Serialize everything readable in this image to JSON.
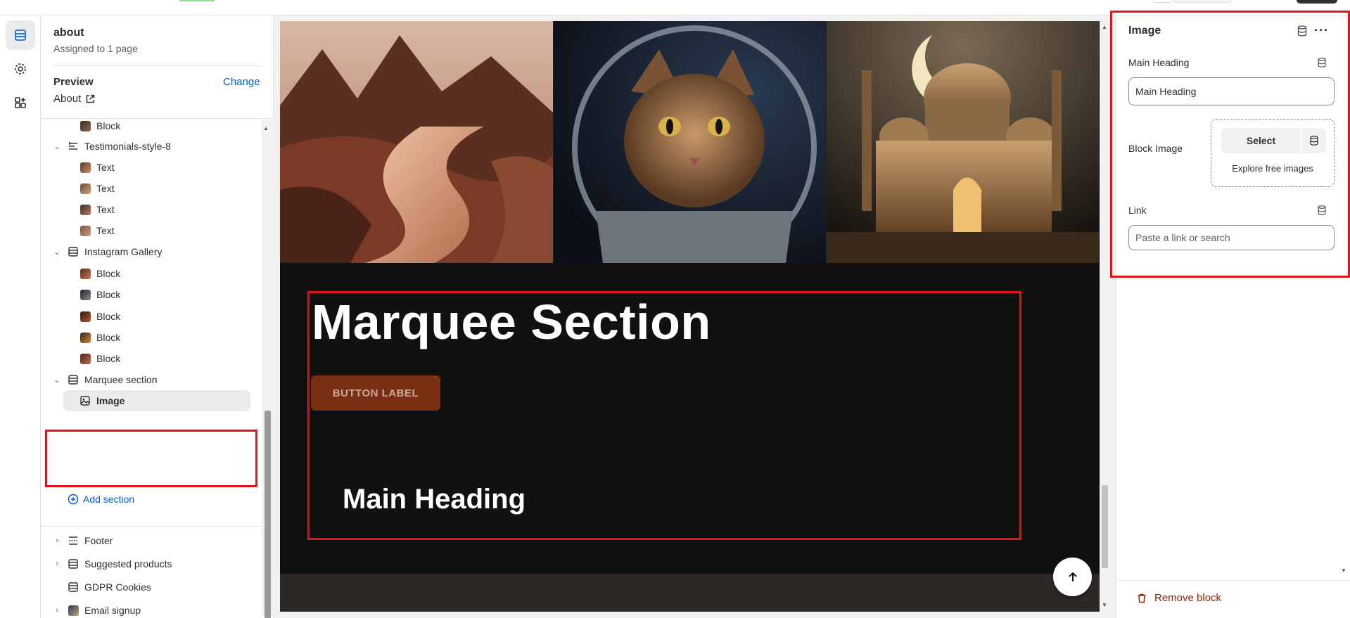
{
  "template": {
    "name": "about",
    "assigned": "Assigned to 1 page"
  },
  "preview": {
    "label": "Preview",
    "change": "Change",
    "page": "About"
  },
  "tree": {
    "top_block": "Block",
    "testimonials": {
      "label": "Testimonials-style-8",
      "items": [
        "Text",
        "Text",
        "Text",
        "Text"
      ]
    },
    "instagram": {
      "label": "Instagram Gallery",
      "items": [
        "Block",
        "Block",
        "Block",
        "Block",
        "Block"
      ]
    },
    "marquee": {
      "label": "Marquee section",
      "item": "Image"
    },
    "add_section": "Add section",
    "footer_sections": [
      "Footer",
      "Suggested products",
      "GDPR Cookies",
      "Email signup"
    ]
  },
  "canvas": {
    "marquee_title": "Marquee Section",
    "button_label": "BUTTON LABEL",
    "main_heading": "Main Heading"
  },
  "panel": {
    "title": "Image",
    "more": "···",
    "main_heading_label": "Main Heading",
    "main_heading_value": "Main Heading",
    "block_image_label": "Block Image",
    "select_label": "Select",
    "explore_label": "Explore free images",
    "link_label": "Link",
    "link_placeholder": "Paste a link or search",
    "remove_label": "Remove block"
  },
  "colors": {
    "accent_link": "#005bd3",
    "highlight": "#e0141b",
    "button_bg": "#7a2f12",
    "canvas_bg": "#121010",
    "remove": "#8e1f0b"
  },
  "icons": [
    "sections-icon",
    "settings-icon",
    "apps-icon",
    "external-link-icon",
    "chevron-down-icon",
    "chevron-right-icon",
    "section-icon",
    "image-icon",
    "add-circle-icon",
    "database-icon",
    "more-icon",
    "arrow-up-icon",
    "trash-icon"
  ]
}
